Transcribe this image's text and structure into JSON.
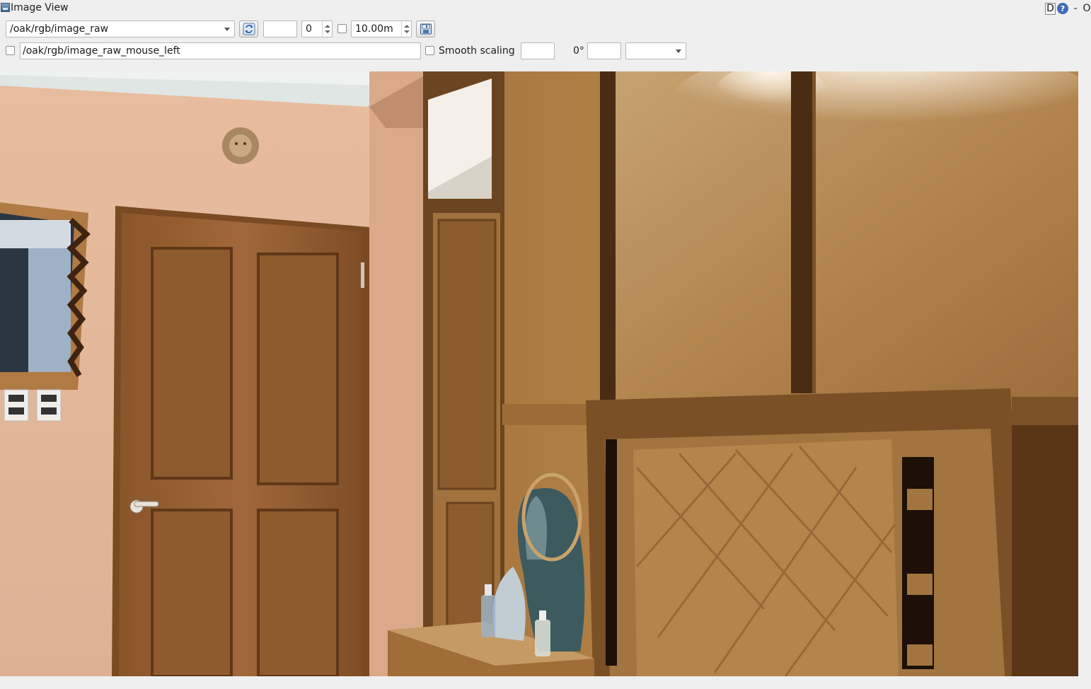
{
  "window": {
    "title": "Image View",
    "title_buttons": {
      "d_label": "D",
      "help_label": "?",
      "minimize_label": "-",
      "close_label": "O"
    }
  },
  "toolbar": {
    "topic_combo": {
      "value": "/oak/rgb/image_raw"
    },
    "refresh_icon": "refresh-icon",
    "blank_field_1": "",
    "spin_value": "0",
    "max_range_spin": {
      "value": "10.00m"
    },
    "save_icon": "save-icon"
  },
  "row2": {
    "mouse_publish_checked": false,
    "mouse_topic": "/oak/rgb/image_raw_mouse_left",
    "smooth_scaling_checked": false,
    "smooth_scaling_label": "Smooth scaling",
    "rotation_label": "0°",
    "blank_field_2": "",
    "blank_field_3": "",
    "dropdown_value": ""
  },
  "image": {
    "description_name": "camera-image"
  },
  "colors": {
    "window_bg": "#efefef",
    "wall": "#e7b99d",
    "wood": "#9a6a3a",
    "wood_light": "#b98a4c",
    "ceiling": "#e4ecec"
  }
}
